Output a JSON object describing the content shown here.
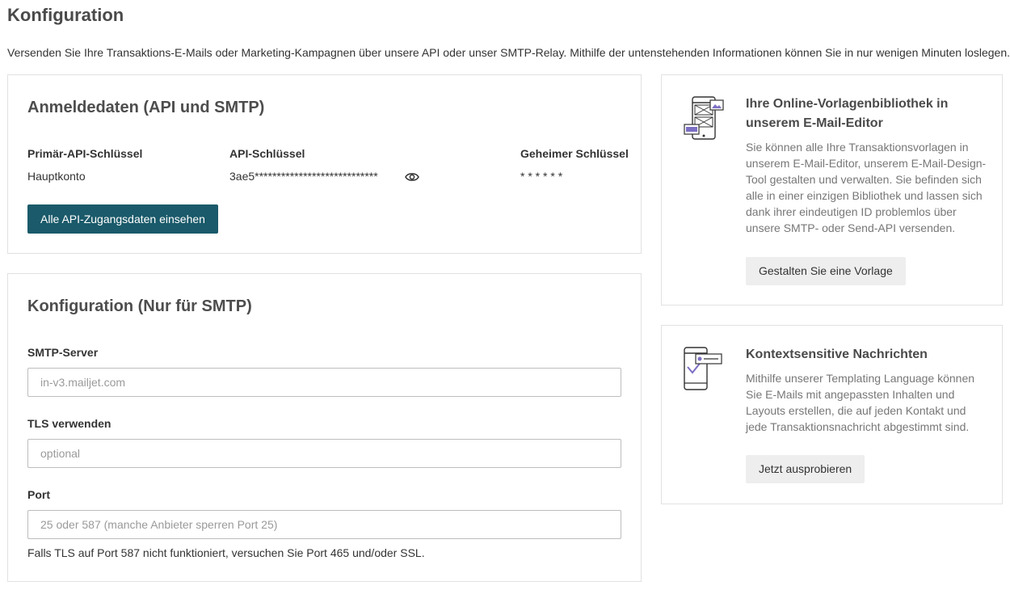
{
  "page": {
    "title": "Konfiguration",
    "intro": "Versenden Sie Ihre Transaktions-E-Mails oder Marketing-Kampagnen über unsere API oder unser SMTP-Relay. Mithilfe der untenstehenden Informationen können Sie in nur wenigen Minuten loslegen."
  },
  "credentials": {
    "title": "Anmeldedaten (API und SMTP)",
    "col_primary": "Primär-API-Schlüssel",
    "col_api_key": "API-Schlüssel",
    "col_secret": "Geheimer Schlüssel",
    "account": "Hauptkonto",
    "api_key": "3ae5****************************",
    "secret": "* * * * * *",
    "button": "Alle API-Zugangsdaten einsehen"
  },
  "smtp": {
    "title": "Konfiguration (Nur für SMTP)",
    "server_label": "SMTP-Server",
    "server_placeholder": "in-v3.mailjet.com",
    "tls_label": "TLS verwenden",
    "tls_placeholder": "optional",
    "port_label": "Port",
    "port_placeholder": "25 oder 587 (manche Anbieter sperren Port 25)",
    "help": "Falls TLS auf Port 587 nicht funktioniert, versuchen Sie Port 465 und/oder SSL."
  },
  "sidebar": {
    "templates": {
      "icon": "template-library-icon",
      "title": "Ihre Online-Vorlagenbibliothek in unserem E-Mail-Editor",
      "text": "Sie können alle Ihre Transaktionsvorlagen in unserem E-Mail-Editor, unserem E-Mail-Design-Tool gestalten und verwalten. Sie befinden sich alle in einer einzigen Bibliothek und lassen sich dank ihrer eindeutigen ID problemlos über unsere SMTP- oder Send-API versenden.",
      "button": "Gestalten Sie eine Vorlage"
    },
    "contextual": {
      "icon": "contextual-message-icon",
      "title": "Kontextsensitive Nachrichten",
      "text": "Mithilfe unserer Templating Language können Sie E-Mails mit angepassten Inhalten und Layouts erstellen, die auf jeden Kontakt und jede Transaktionsnachricht abgestimmt sind.",
      "button": "Jetzt ausprobieren"
    }
  },
  "colors": {
    "primary_button": "#1a5a6a",
    "icon_accent": "#7b6fc4"
  }
}
